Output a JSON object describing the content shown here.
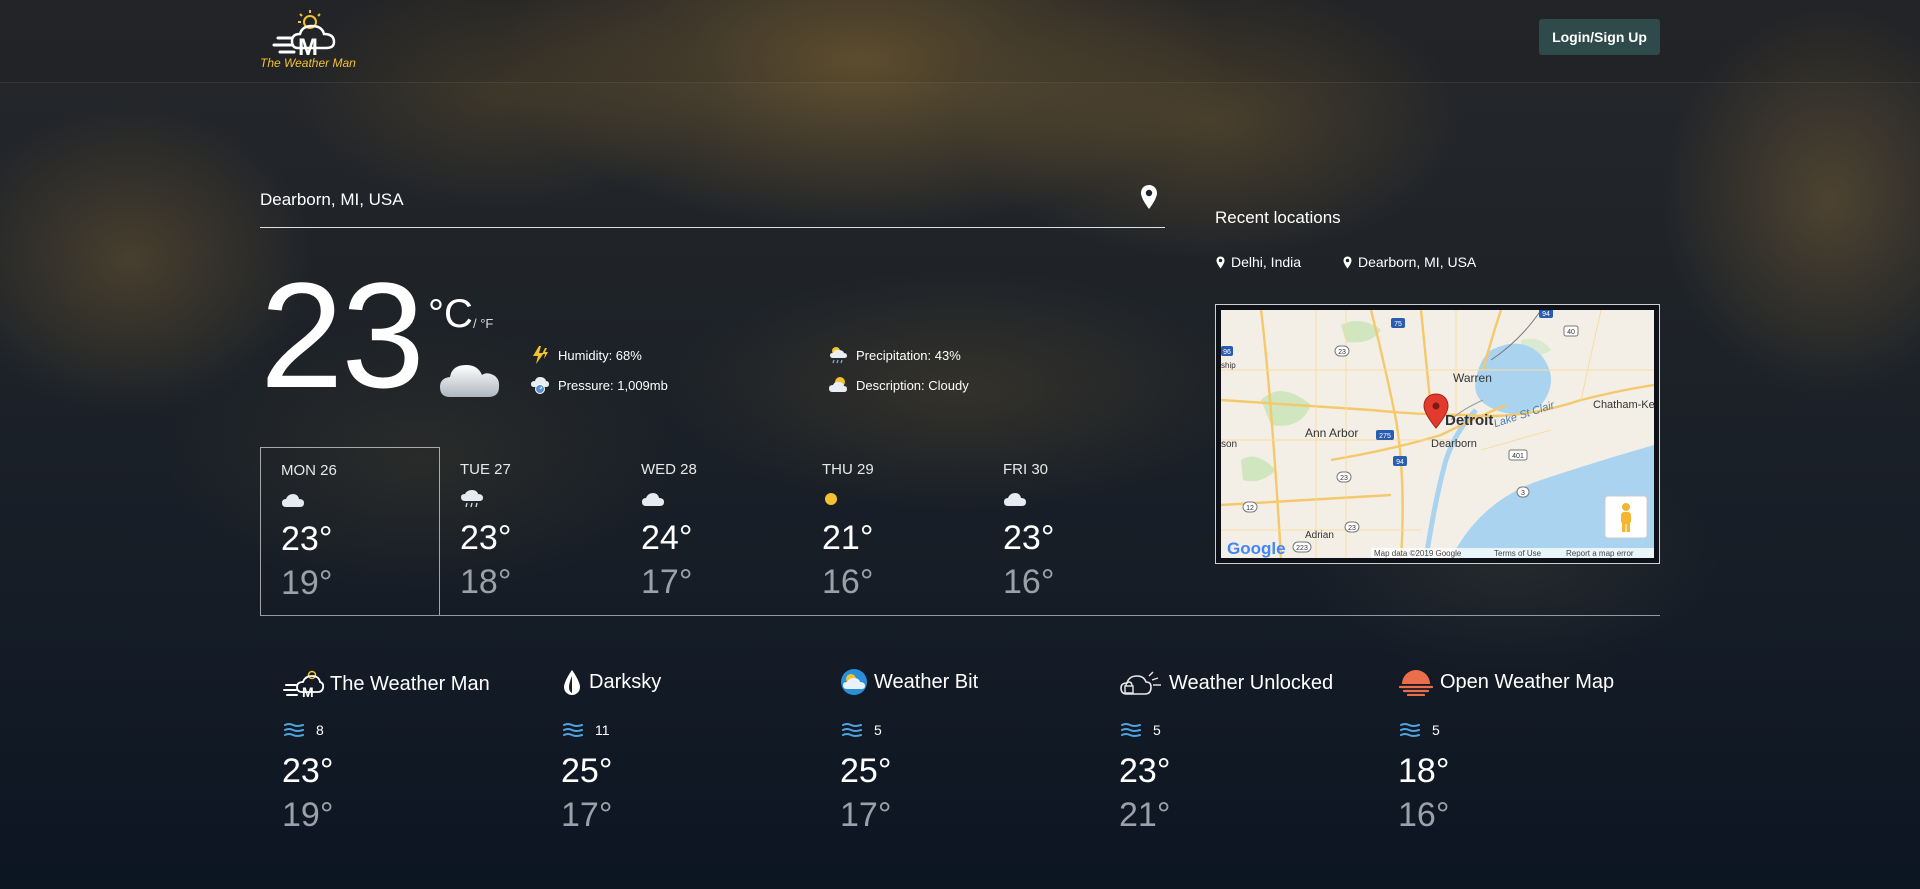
{
  "header": {
    "logo_text": "The Weather Man",
    "login_label": "Login/Sign Up"
  },
  "search": {
    "location_value": "Dearborn, MI, USA"
  },
  "current": {
    "temperature": "23",
    "unit_c": "°C",
    "unit_f": "/ °F",
    "humidity": "Humidity: 68%",
    "pressure": "Pressure: 1,009mb",
    "precipitation": "Precipitation: 43%",
    "description": "Description: Cloudy",
    "icon": "cloud-icon"
  },
  "recent": {
    "title": "Recent locations",
    "items": [
      "Delhi, India",
      "Dearborn, MI, USA"
    ]
  },
  "map": {
    "labels": {
      "detroit": "Detroit",
      "dearborn": "Dearborn",
      "ann_arbor": "Ann Arbor",
      "warren": "Warren",
      "chatham": "Chatham-Kent",
      "lake": "Lake St Clair",
      "adrian": "Adrian",
      "ripple": "Map data ©2019 Google",
      "terms": "Terms of Use",
      "report": "Report a map error",
      "google": "Google",
      "son": "son",
      "chip": "ship"
    },
    "road_labels": [
      "75",
      "23",
      "96",
      "275",
      "94",
      "23",
      "12",
      "401",
      "3",
      "23",
      "40",
      "94",
      "223"
    ]
  },
  "forecast": [
    {
      "day": "MON 26",
      "hi": "23°",
      "lo": "19°",
      "icon": "cloud-icon",
      "selected": true
    },
    {
      "day": "TUE 27",
      "hi": "23°",
      "lo": "18°",
      "icon": "rain-cloud-icon",
      "selected": false
    },
    {
      "day": "WED 28",
      "hi": "24°",
      "lo": "17°",
      "icon": "cloud-icon",
      "selected": false
    },
    {
      "day": "THU 29",
      "hi": "21°",
      "lo": "16°",
      "icon": "sun-icon",
      "selected": false
    },
    {
      "day": "FRI 30",
      "hi": "23°",
      "lo": "16°",
      "icon": "cloud-icon",
      "selected": false
    }
  ],
  "sources": [
    {
      "name": "The Weather Man",
      "wind": "8",
      "hi": "23°",
      "lo": "19°",
      "icon": "weather-man-logo-icon"
    },
    {
      "name": "Darksky",
      "wind": "11",
      "hi": "25°",
      "lo": "17°",
      "icon": "darksky-logo-icon"
    },
    {
      "name": "Weather Bit",
      "wind": "5",
      "hi": "25°",
      "lo": "17°",
      "icon": "weatherbit-logo-icon"
    },
    {
      "name": "Weather Unlocked",
      "wind": "5",
      "hi": "23°",
      "lo": "21°",
      "icon": "weather-unlocked-logo-icon"
    },
    {
      "name": "Open Weather Map",
      "wind": "5",
      "hi": "18°",
      "lo": "16°",
      "icon": "openweathermap-logo-icon"
    }
  ],
  "colors": {
    "login_bg": "#2f4a4a",
    "logo_text": "#f2c230",
    "wind_icon": "#4fa3e0",
    "owm_orange": "#eb6e4b",
    "weatherbit_blue": "#2a8fd8"
  }
}
